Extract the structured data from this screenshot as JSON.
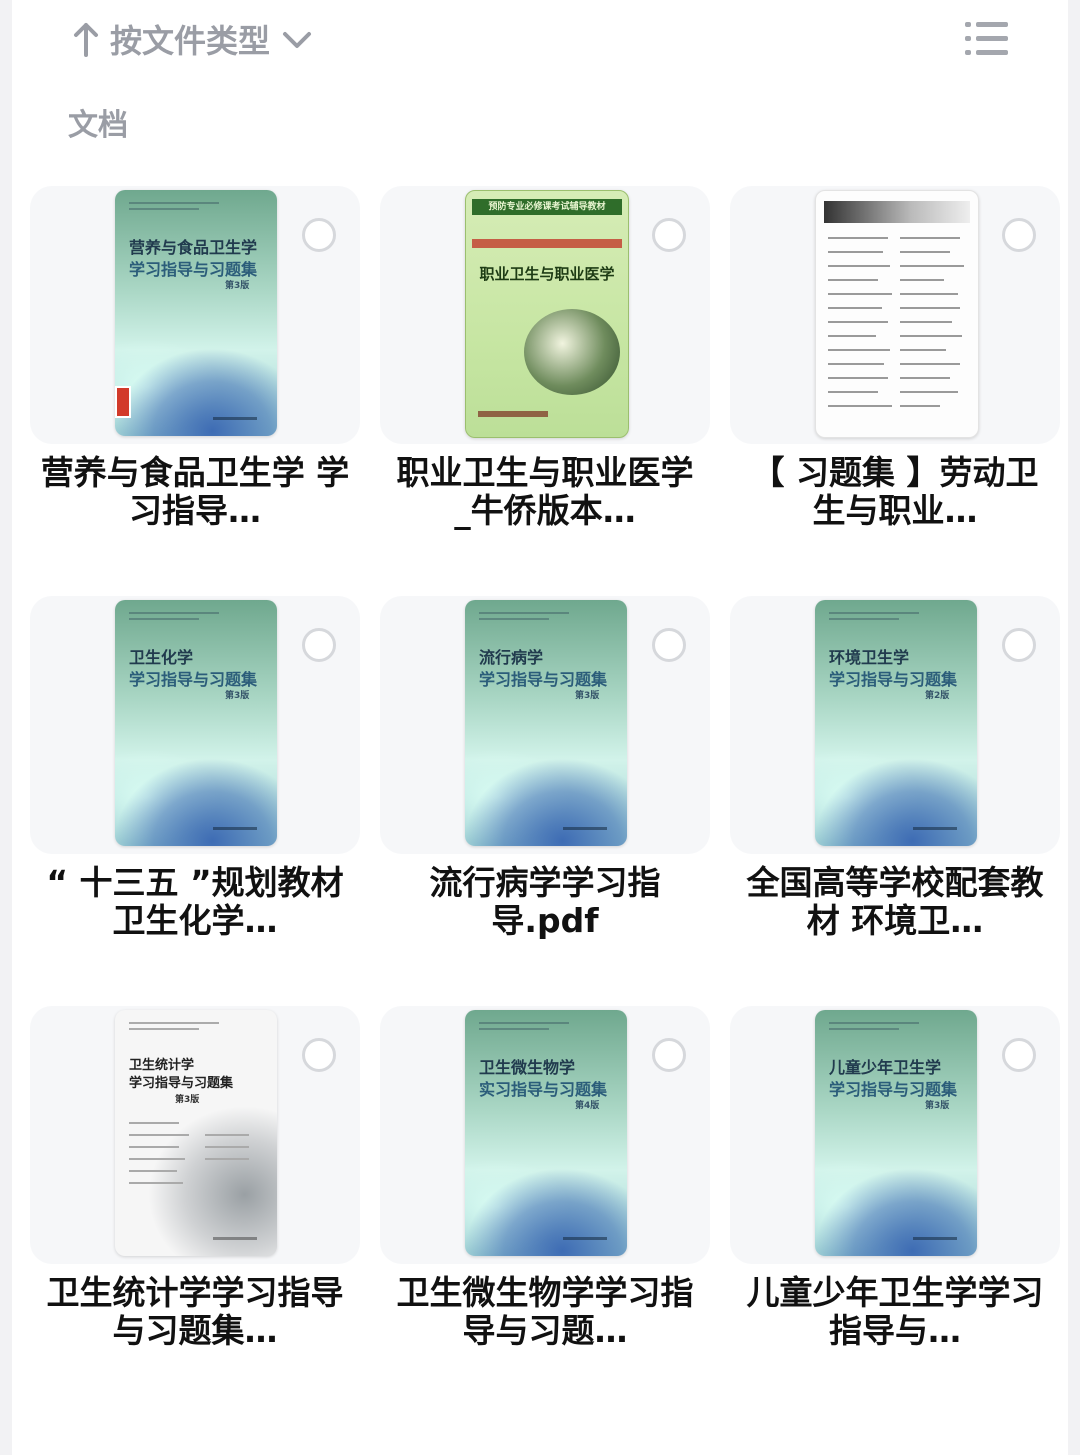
{
  "header": {
    "sort_label": "按文件类型"
  },
  "section": {
    "title": "文档"
  },
  "files": [
    {
      "name": "营养与食品卫生学 学习指导…",
      "cover": {
        "line1": "营养与食品卫生学",
        "line2": "学习指导与习题集",
        "edition": "第3版"
      }
    },
    {
      "name": "职业卫生与职业医学_牛侨版本…",
      "cover": {
        "banner": "预防专业必修课考试辅导教材",
        "title": "职业卫生与职业医学"
      }
    },
    {
      "name": "【 习题集 】劳动卫生与职业…",
      "cover": {}
    },
    {
      "name": "“ 十三五 ”规划教材 卫生化学…",
      "cover": {
        "line1": "卫生化学",
        "line2": "学习指导与习题集",
        "edition": "第3版"
      }
    },
    {
      "name": "流行病学学习指导.pdf",
      "cover": {
        "line1": "流行病学",
        "line2": "学习指导与习题集",
        "edition": "第3版"
      }
    },
    {
      "name": "全国高等学校配套教材 环境卫…",
      "cover": {
        "line1": "环境卫生学",
        "line2": "学习指导与习题集",
        "edition": "第2版"
      }
    },
    {
      "name": "卫生统计学学习指导与习题集…",
      "cover": {
        "line1": "卫生统计学",
        "line2": "学习指导与习题集",
        "edition": "第3版"
      }
    },
    {
      "name": "卫生微生物学学习指导与习题…",
      "cover": {
        "line1": "卫生微生物学",
        "line2": "实习指导与习题集",
        "edition": "第4版"
      }
    },
    {
      "name": "儿童少年卫生学学习指导与…",
      "cover": {
        "line1": "儿童少年卫生学",
        "line2": "学习指导与习题集",
        "edition": "第3版"
      }
    }
  ]
}
